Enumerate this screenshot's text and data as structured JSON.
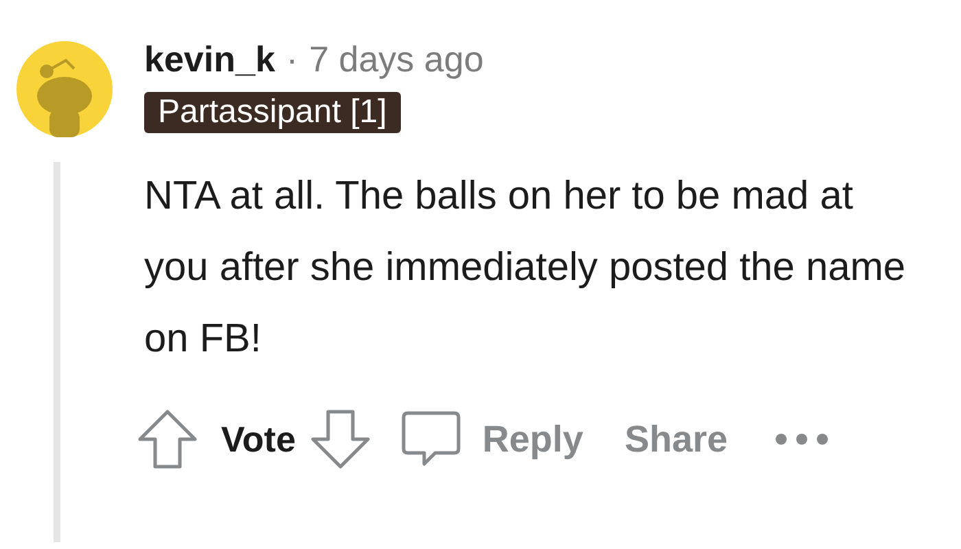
{
  "comment": {
    "author": "kevin_k",
    "separator": "·",
    "time": "7 days ago",
    "flair": "Partassipant [1]",
    "body": "NTA at all. The balls on her to be mad at you after she immediately posted the name on FB!",
    "actions": [
      {
        "kind": "upvote"
      },
      {
        "kind": "label",
        "text": "Vote"
      },
      {
        "kind": "downvote"
      },
      {
        "kind": "reply",
        "text": "Reply"
      },
      {
        "kind": "share",
        "text": "Share"
      },
      {
        "kind": "more"
      }
    ]
  }
}
